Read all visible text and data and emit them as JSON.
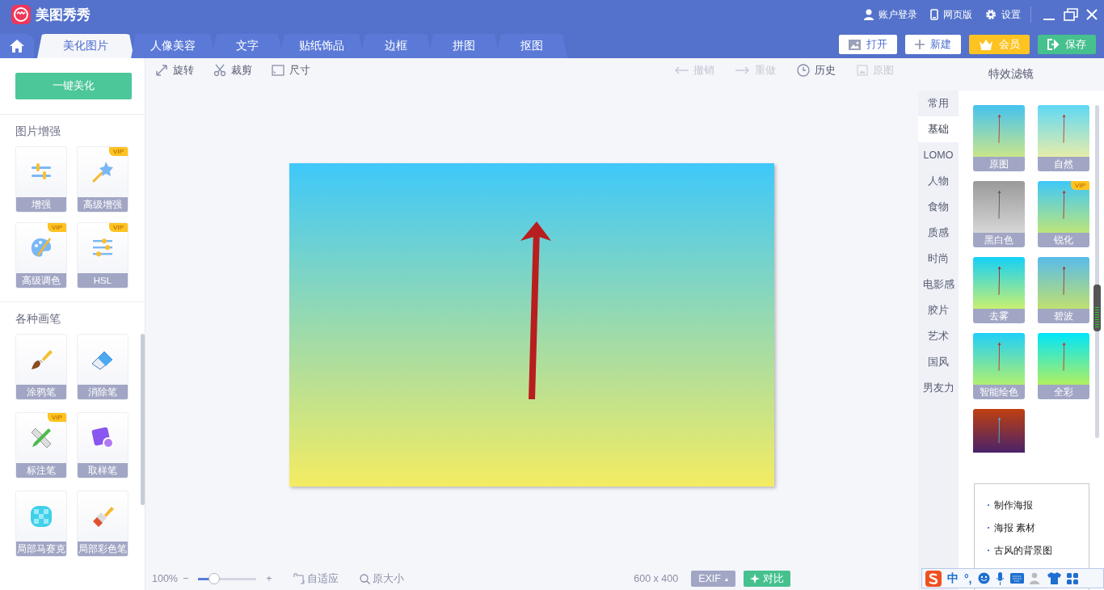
{
  "app": {
    "title": "美图秀秀"
  },
  "top_links": [
    {
      "label": "账户登录"
    },
    {
      "label": "网页版"
    },
    {
      "label": "设置"
    }
  ],
  "tabs": [
    {
      "label": "美化图片",
      "selected": true
    },
    {
      "label": "人像美容",
      "selected": false
    },
    {
      "label": "文字",
      "selected": false
    },
    {
      "label": "贴纸饰品",
      "selected": false
    },
    {
      "label": "边框",
      "selected": false
    },
    {
      "label": "拼图",
      "selected": false
    },
    {
      "label": "抠图",
      "selected": false
    }
  ],
  "actions": [
    {
      "label": "打开",
      "kind": "open"
    },
    {
      "label": "新建",
      "kind": "new"
    },
    {
      "label": "会员",
      "kind": "vip"
    },
    {
      "label": "保存",
      "kind": "save"
    }
  ],
  "left_panel": {
    "primary_button": "一键美化",
    "sections": [
      {
        "title": "图片增强",
        "tools": [
          {
            "label": "增强"
          },
          {
            "label": "高级增强",
            "badge": "VIP"
          },
          {
            "label": "高级调色",
            "badge": "VIP"
          },
          {
            "label": "HSL",
            "badge": "VIP"
          }
        ]
      },
      {
        "title": "各种画笔",
        "tools": [
          {
            "label": "涂鸦笔"
          },
          {
            "label": "消除笔"
          },
          {
            "label": "标注笔",
            "badge": "VIP"
          },
          {
            "label": "取样笔"
          },
          {
            "label": "局部马赛克"
          },
          {
            "label": "局部彩色笔"
          }
        ]
      }
    ]
  },
  "toolbar": {
    "left": [
      {
        "label": "旋转",
        "disabled": false
      },
      {
        "label": "裁剪",
        "disabled": false
      },
      {
        "label": "尺寸",
        "disabled": false
      }
    ],
    "right": [
      {
        "label": "撤销",
        "disabled": true
      },
      {
        "label": "重做",
        "disabled": true
      },
      {
        "label": "历史",
        "disabled": false
      },
      {
        "label": "原图",
        "disabled": true
      }
    ]
  },
  "status_bar": {
    "zoom": "100%",
    "zoom_out": "−",
    "zoom_slider": {
      "level": 0.27
    },
    "zoom_in": "+",
    "fit": "自适应",
    "actual_size": "原大小",
    "dimensions": "600 x 400",
    "exif": "EXIF",
    "exif_caret": "▴",
    "compare": "对比"
  },
  "filter_panel": {
    "title": "特效滤镜",
    "categories": [
      {
        "label": "常用",
        "selected": false
      },
      {
        "label": "基础",
        "selected": true
      },
      {
        "label": "LOMO",
        "selected": false
      },
      {
        "label": "人物",
        "selected": false
      },
      {
        "label": "食物",
        "selected": false
      },
      {
        "label": "质感",
        "selected": false
      },
      {
        "label": "时尚",
        "selected": false
      },
      {
        "label": "电影感",
        "selected": false
      },
      {
        "label": "胶片",
        "selected": false
      },
      {
        "label": "艺术",
        "selected": false
      },
      {
        "label": "国风",
        "selected": false
      },
      {
        "label": "男友力",
        "selected": false
      }
    ],
    "filters": [
      {
        "label": "原图"
      },
      {
        "label": "自然"
      },
      {
        "label": "黑白色"
      },
      {
        "label": "锐化",
        "badge": "VIP"
      },
      {
        "label": "去雾"
      },
      {
        "label": "碧波"
      },
      {
        "label": "智能绘色"
      },
      {
        "label": "全彩"
      },
      {
        "kind": "partial"
      }
    ]
  },
  "suggestions": [
    {
      "label": "制作海报"
    },
    {
      "label": "海报 素材"
    },
    {
      "label": "古风的背景图"
    }
  ],
  "ime_bar": {
    "mode": "中",
    "punct": "°,"
  }
}
